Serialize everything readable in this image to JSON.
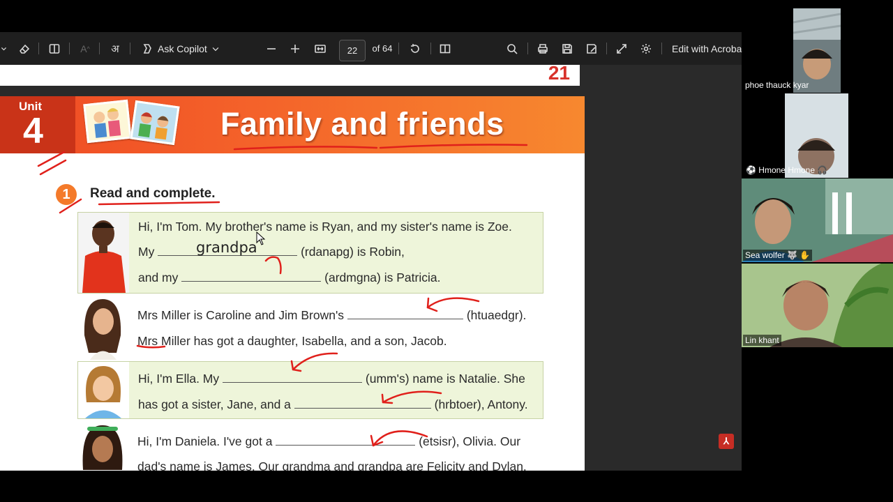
{
  "toolbar": {
    "copilot_label": "Ask Copilot",
    "page_current": "22",
    "page_total": "of 64",
    "edit_label": "Edit with Acroba"
  },
  "document": {
    "prev_page_number": "21",
    "unit_label": "Unit",
    "unit_number": "4",
    "title": "Family and friends",
    "exercise_number": "1",
    "exercise_title": "Read and complete.",
    "rows": [
      {
        "lines": [
          "Hi, I'm Tom. My brother's name is Ryan, and my sister's name is Zoe.",
          "My",
          "(rdanapg) is Robin,",
          "and my",
          "(ardmgna) is Patricia."
        ],
        "handwritten_answer": "grandpa"
      },
      {
        "lines": [
          "Mrs Miller is Caroline and Jim Brown's",
          "(htuaedgr).",
          "Mrs Miller has got a daughter, Isabella, and a son, Jacob."
        ]
      },
      {
        "lines": [
          "Hi, I'm Ella. My",
          "(umm's) name is Natalie. She",
          "has got a sister, Jane, and a",
          "(hrbtoer), Antony."
        ]
      },
      {
        "lines": [
          "Hi, I'm Daniela. I've got a",
          "(etsisr), Olivia. Our",
          "dad's name is James. Our grandma and grandpa are Felicity and Dylan."
        ]
      }
    ]
  },
  "participants": [
    {
      "name": "phoe thauck kyar"
    },
    {
      "name": "Hmone Hmone"
    },
    {
      "name": "Sea wolfer"
    },
    {
      "name": "Lin khant"
    }
  ],
  "colors": {
    "banner": "#f4632a",
    "accent_red": "#d8322b",
    "row_green": "#eef5da",
    "ink_red": "#e0201b"
  }
}
